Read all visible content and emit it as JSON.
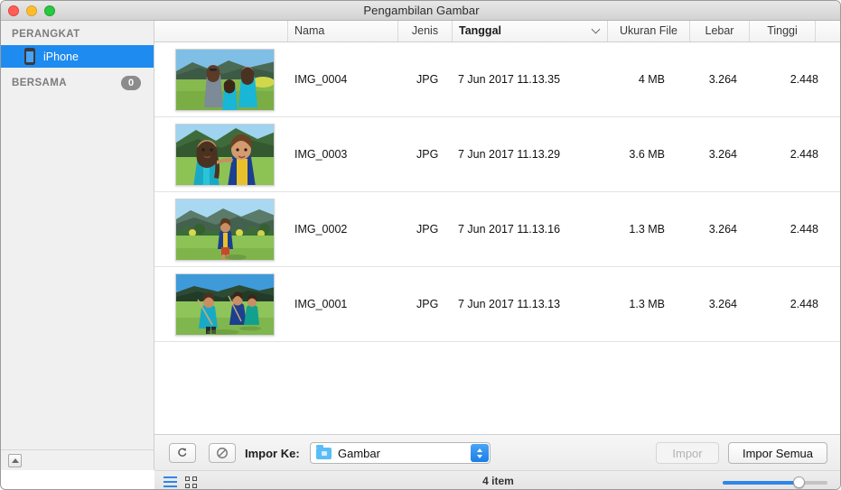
{
  "window": {
    "title": "Pengambilan Gambar",
    "traffic_lights": [
      "close",
      "minimize",
      "maximize"
    ],
    "accent_color": "#1e8bf0"
  },
  "sidebar": {
    "devices_header": "PERANGKAT",
    "devices": [
      {
        "label": "iPhone",
        "icon": "iphone-icon",
        "selected": true
      }
    ],
    "shared_header": "BERSAMA",
    "shared_count": "0",
    "eject_icon": "eject-icon"
  },
  "columns": [
    {
      "key": "thumb",
      "label": "",
      "sorted": false
    },
    {
      "key": "name",
      "label": "Nama",
      "sorted": false
    },
    {
      "key": "type",
      "label": "Jenis",
      "sorted": false
    },
    {
      "key": "date",
      "label": "Tanggal",
      "sorted": true
    },
    {
      "key": "size",
      "label": "Ukuran File",
      "sorted": false
    },
    {
      "key": "width",
      "label": "Lebar",
      "sorted": false
    },
    {
      "key": "height",
      "label": "Tinggi",
      "sorted": false
    }
  ],
  "rows": [
    {
      "name": "IMG_0004",
      "type": "JPG",
      "date": "7 Jun 2017 11.13.35",
      "size": "4 MB",
      "width": "3.264",
      "height": "2.448",
      "thumb": "family-portrait-meadow"
    },
    {
      "name": "IMG_0003",
      "type": "JPG",
      "date": "7 Jun 2017 11.13.29",
      "size": "3.6 MB",
      "width": "3.264",
      "height": "2.448",
      "thumb": "two-children-closeup"
    },
    {
      "name": "IMG_0002",
      "type": "JPG",
      "date": "7 Jun 2017 11.13.16",
      "size": "1.3 MB",
      "width": "3.264",
      "height": "2.448",
      "thumb": "child-standing-field"
    },
    {
      "name": "IMG_0001",
      "type": "JPG",
      "date": "7 Jun 2017 11.13.13",
      "size": "1.3 MB",
      "width": "3.264",
      "height": "2.448",
      "thumb": "group-hiking-field"
    }
  ],
  "toolbar": {
    "rotate_icon": "rotate-icon",
    "delete_icon": "no-entry-icon",
    "import_to_label": "Impor Ke:",
    "destination": "Gambar",
    "destination_icon": "pictures-folder-icon",
    "import_button": "Impor",
    "import_button_disabled": true,
    "import_all_button": "Impor Semua"
  },
  "statusbar": {
    "list_view_icon": "list-view-icon",
    "grid_view_icon": "grid-view-icon",
    "active_view": "list",
    "item_count": "4 item",
    "zoom_slider_percent": 73
  }
}
